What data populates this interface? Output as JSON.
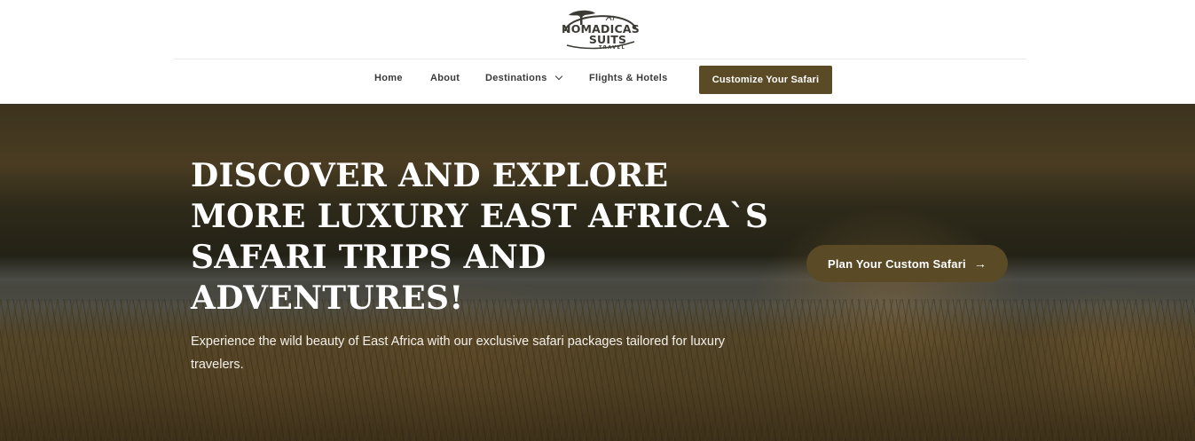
{
  "brand": {
    "logo_line1": "NOMADICAS",
    "logo_line2": "SUITS",
    "logo_sub": "TRAVEL"
  },
  "nav": {
    "items": [
      {
        "label": "Home"
      },
      {
        "label": "About"
      },
      {
        "label": "Destinations"
      },
      {
        "label": "Flights & Hotels"
      }
    ],
    "cta_label": "Customize Your Safari"
  },
  "hero": {
    "title": "DISCOVER AND EXPLORE MORE LUXURY EAST AFRICA`S SAFARI TRIPS AND ADVENTURES!",
    "description": "Experience the wild beauty of East Africa with our exclusive safari packages tailored for luxury travelers.",
    "cta_label": "Plan Your Custom Safari",
    "cta_icon": "arrow-right-icon"
  },
  "colors": {
    "accent": "#5a4a25",
    "white": "#ffffff",
    "nav_text": "#3a3a3a"
  }
}
